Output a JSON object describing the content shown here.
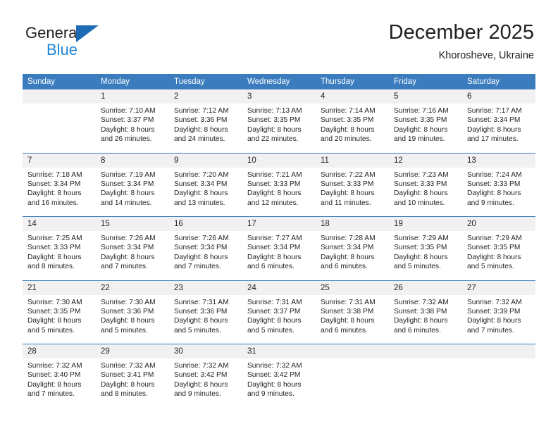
{
  "brand": {
    "general": "General",
    "blue": "Blue",
    "triangle_color": "#1d6ab5",
    "blue_color": "#1f86d8"
  },
  "header": {
    "month_title": "December 2025",
    "location": "Khorosheve, Ukraine"
  },
  "theme": {
    "header_bg": "#3a7cbe",
    "daynum_bg": "#f1f1f1",
    "separator": "#3a7cbe",
    "text": "#231f20"
  },
  "weekday_headers": [
    "Sunday",
    "Monday",
    "Tuesday",
    "Wednesday",
    "Thursday",
    "Friday",
    "Saturday"
  ],
  "weeks": [
    [
      {
        "day": "",
        "lines": []
      },
      {
        "day": "1",
        "lines": [
          "Sunrise: 7:10 AM",
          "Sunset: 3:37 PM",
          "Daylight: 8 hours",
          "and 26 minutes."
        ]
      },
      {
        "day": "2",
        "lines": [
          "Sunrise: 7:12 AM",
          "Sunset: 3:36 PM",
          "Daylight: 8 hours",
          "and 24 minutes."
        ]
      },
      {
        "day": "3",
        "lines": [
          "Sunrise: 7:13 AM",
          "Sunset: 3:35 PM",
          "Daylight: 8 hours",
          "and 22 minutes."
        ]
      },
      {
        "day": "4",
        "lines": [
          "Sunrise: 7:14 AM",
          "Sunset: 3:35 PM",
          "Daylight: 8 hours",
          "and 20 minutes."
        ]
      },
      {
        "day": "5",
        "lines": [
          "Sunrise: 7:16 AM",
          "Sunset: 3:35 PM",
          "Daylight: 8 hours",
          "and 19 minutes."
        ]
      },
      {
        "day": "6",
        "lines": [
          "Sunrise: 7:17 AM",
          "Sunset: 3:34 PM",
          "Daylight: 8 hours",
          "and 17 minutes."
        ]
      }
    ],
    [
      {
        "day": "7",
        "lines": [
          "Sunrise: 7:18 AM",
          "Sunset: 3:34 PM",
          "Daylight: 8 hours",
          "and 16 minutes."
        ]
      },
      {
        "day": "8",
        "lines": [
          "Sunrise: 7:19 AM",
          "Sunset: 3:34 PM",
          "Daylight: 8 hours",
          "and 14 minutes."
        ]
      },
      {
        "day": "9",
        "lines": [
          "Sunrise: 7:20 AM",
          "Sunset: 3:34 PM",
          "Daylight: 8 hours",
          "and 13 minutes."
        ]
      },
      {
        "day": "10",
        "lines": [
          "Sunrise: 7:21 AM",
          "Sunset: 3:33 PM",
          "Daylight: 8 hours",
          "and 12 minutes."
        ]
      },
      {
        "day": "11",
        "lines": [
          "Sunrise: 7:22 AM",
          "Sunset: 3:33 PM",
          "Daylight: 8 hours",
          "and 11 minutes."
        ]
      },
      {
        "day": "12",
        "lines": [
          "Sunrise: 7:23 AM",
          "Sunset: 3:33 PM",
          "Daylight: 8 hours",
          "and 10 minutes."
        ]
      },
      {
        "day": "13",
        "lines": [
          "Sunrise: 7:24 AM",
          "Sunset: 3:33 PM",
          "Daylight: 8 hours",
          "and 9 minutes."
        ]
      }
    ],
    [
      {
        "day": "14",
        "lines": [
          "Sunrise: 7:25 AM",
          "Sunset: 3:33 PM",
          "Daylight: 8 hours",
          "and 8 minutes."
        ]
      },
      {
        "day": "15",
        "lines": [
          "Sunrise: 7:26 AM",
          "Sunset: 3:34 PM",
          "Daylight: 8 hours",
          "and 7 minutes."
        ]
      },
      {
        "day": "16",
        "lines": [
          "Sunrise: 7:26 AM",
          "Sunset: 3:34 PM",
          "Daylight: 8 hours",
          "and 7 minutes."
        ]
      },
      {
        "day": "17",
        "lines": [
          "Sunrise: 7:27 AM",
          "Sunset: 3:34 PM",
          "Daylight: 8 hours",
          "and 6 minutes."
        ]
      },
      {
        "day": "18",
        "lines": [
          "Sunrise: 7:28 AM",
          "Sunset: 3:34 PM",
          "Daylight: 8 hours",
          "and 6 minutes."
        ]
      },
      {
        "day": "19",
        "lines": [
          "Sunrise: 7:29 AM",
          "Sunset: 3:35 PM",
          "Daylight: 8 hours",
          "and 5 minutes."
        ]
      },
      {
        "day": "20",
        "lines": [
          "Sunrise: 7:29 AM",
          "Sunset: 3:35 PM",
          "Daylight: 8 hours",
          "and 5 minutes."
        ]
      }
    ],
    [
      {
        "day": "21",
        "lines": [
          "Sunrise: 7:30 AM",
          "Sunset: 3:35 PM",
          "Daylight: 8 hours",
          "and 5 minutes."
        ]
      },
      {
        "day": "22",
        "lines": [
          "Sunrise: 7:30 AM",
          "Sunset: 3:36 PM",
          "Daylight: 8 hours",
          "and 5 minutes."
        ]
      },
      {
        "day": "23",
        "lines": [
          "Sunrise: 7:31 AM",
          "Sunset: 3:36 PM",
          "Daylight: 8 hours",
          "and 5 minutes."
        ]
      },
      {
        "day": "24",
        "lines": [
          "Sunrise: 7:31 AM",
          "Sunset: 3:37 PM",
          "Daylight: 8 hours",
          "and 5 minutes."
        ]
      },
      {
        "day": "25",
        "lines": [
          "Sunrise: 7:31 AM",
          "Sunset: 3:38 PM",
          "Daylight: 8 hours",
          "and 6 minutes."
        ]
      },
      {
        "day": "26",
        "lines": [
          "Sunrise: 7:32 AM",
          "Sunset: 3:38 PM",
          "Daylight: 8 hours",
          "and 6 minutes."
        ]
      },
      {
        "day": "27",
        "lines": [
          "Sunrise: 7:32 AM",
          "Sunset: 3:39 PM",
          "Daylight: 8 hours",
          "and 7 minutes."
        ]
      }
    ],
    [
      {
        "day": "28",
        "lines": [
          "Sunrise: 7:32 AM",
          "Sunset: 3:40 PM",
          "Daylight: 8 hours",
          "and 7 minutes."
        ]
      },
      {
        "day": "29",
        "lines": [
          "Sunrise: 7:32 AM",
          "Sunset: 3:41 PM",
          "Daylight: 8 hours",
          "and 8 minutes."
        ]
      },
      {
        "day": "30",
        "lines": [
          "Sunrise: 7:32 AM",
          "Sunset: 3:42 PM",
          "Daylight: 8 hours",
          "and 9 minutes."
        ]
      },
      {
        "day": "31",
        "lines": [
          "Sunrise: 7:32 AM",
          "Sunset: 3:42 PM",
          "Daylight: 8 hours",
          "and 9 minutes."
        ]
      },
      {
        "day": "",
        "lines": []
      },
      {
        "day": "",
        "lines": []
      },
      {
        "day": "",
        "lines": []
      }
    ]
  ]
}
